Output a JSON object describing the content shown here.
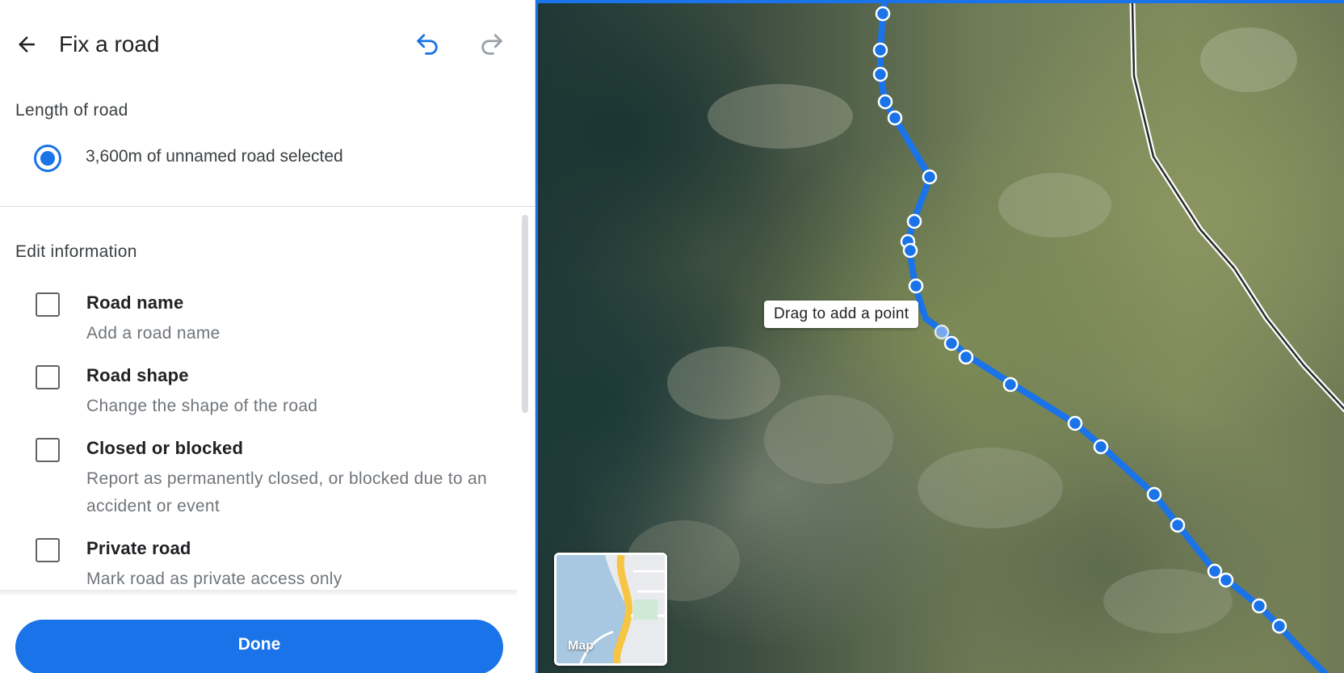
{
  "header": {
    "title": "Fix a road",
    "back_icon": "arrow-back-icon",
    "undo_icon": "undo-icon",
    "redo_icon": "redo-icon"
  },
  "length_section": {
    "label": "Length of road",
    "selection_text": "3,600m of unnamed road selected",
    "selected": true
  },
  "edit_section": {
    "label": "Edit information",
    "options": [
      {
        "title": "Road name",
        "description": "Add a road name",
        "checked": false
      },
      {
        "title": "Road shape",
        "description": "Change the shape of the road",
        "checked": false
      },
      {
        "title": "Closed or blocked",
        "description": "Report as permanently closed, or blocked due to an accident or event",
        "checked": false
      },
      {
        "title": "Private road",
        "description": "Mark road as private access only",
        "checked": false
      }
    ]
  },
  "done_label": "Done",
  "map": {
    "tooltip": "Drag to add a point",
    "layer_label": "Map",
    "route_color": "#1a73e8",
    "view": "satellite"
  },
  "colors": {
    "accent": "#1a73e8",
    "text_primary": "#202124",
    "text_secondary": "#70757a"
  }
}
